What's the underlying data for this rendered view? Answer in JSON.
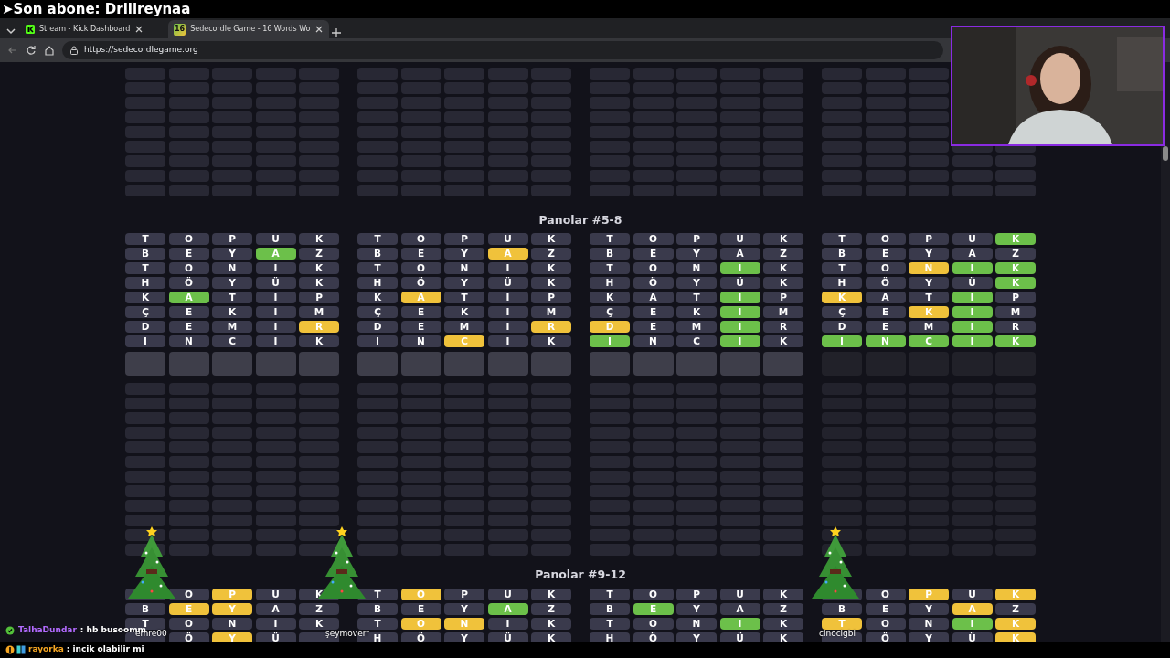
{
  "stream_overlay": {
    "latest_subscriber": "➤Son abone: Drillreynaa"
  },
  "browser": {
    "tabs": [
      {
        "title": "Stream - Kick Dashboard",
        "selected": false
      },
      {
        "title": "Sedecordle Game - 16 Words Wo",
        "selected": true,
        "favicon_text": "16"
      }
    ],
    "url": "https://sedecordlegame.org"
  },
  "sections": [
    {
      "heading": "Panolar #5-8",
      "boards": [
        {
          "solved": false,
          "rows": [
            {
              "tiles": [
                {
                  "letter": "T",
                  "color": "#3a3a4c"
                },
                {
                  "letter": "O",
                  "color": "#3a3a4c"
                },
                {
                  "letter": "P",
                  "color": "#3a3a4c"
                },
                {
                  "letter": "U",
                  "color": "#3a3a4c"
                },
                {
                  "letter": "K",
                  "color": "#3a3a4c"
                }
              ]
            },
            {
              "tiles": [
                {
                  "letter": "B",
                  "color": "#3a3a4c"
                },
                {
                  "letter": "E",
                  "color": "#3a3a4c"
                },
                {
                  "letter": "Y",
                  "color": "#3a3a4c"
                },
                {
                  "letter": "A",
                  "color": "#6cc04a"
                },
                {
                  "letter": "Z",
                  "color": "#3a3a4c"
                }
              ]
            },
            {
              "tiles": [
                {
                  "letter": "T",
                  "color": "#3a3a4c"
                },
                {
                  "letter": "O",
                  "color": "#3a3a4c"
                },
                {
                  "letter": "N",
                  "color": "#3a3a4c"
                },
                {
                  "letter": "I",
                  "color": "#3a3a4c"
                },
                {
                  "letter": "K",
                  "color": "#3a3a4c"
                }
              ]
            },
            {
              "tiles": [
                {
                  "letter": "H",
                  "color": "#3a3a4c"
                },
                {
                  "letter": "Ö",
                  "color": "#3a3a4c"
                },
                {
                  "letter": "Y",
                  "color": "#3a3a4c"
                },
                {
                  "letter": "Ü",
                  "color": "#3a3a4c"
                },
                {
                  "letter": "K",
                  "color": "#3a3a4c"
                }
              ]
            },
            {
              "tiles": [
                {
                  "letter": "K",
                  "color": "#3a3a4c"
                },
                {
                  "letter": "A",
                  "color": "#6cc04a"
                },
                {
                  "letter": "T",
                  "color": "#3a3a4c"
                },
                {
                  "letter": "I",
                  "color": "#3a3a4c"
                },
                {
                  "letter": "P",
                  "color": "#3a3a4c"
                }
              ]
            },
            {
              "tiles": [
                {
                  "letter": "Ç",
                  "color": "#3a3a4c"
                },
                {
                  "letter": "E",
                  "color": "#3a3a4c"
                },
                {
                  "letter": "K",
                  "color": "#3a3a4c"
                },
                {
                  "letter": "I",
                  "color": "#3a3a4c"
                },
                {
                  "letter": "M",
                  "color": "#3a3a4c"
                }
              ]
            },
            {
              "tiles": [
                {
                  "letter": "D",
                  "color": "#3a3a4c"
                },
                {
                  "letter": "E",
                  "color": "#3a3a4c"
                },
                {
                  "letter": "M",
                  "color": "#3a3a4c"
                },
                {
                  "letter": "I",
                  "color": "#3a3a4c"
                },
                {
                  "letter": "R",
                  "color": "#f0c23b"
                }
              ]
            },
            {
              "tiles": [
                {
                  "letter": "I",
                  "color": "#3a3a4c"
                },
                {
                  "letter": "N",
                  "color": "#3a3a4c"
                },
                {
                  "letter": "C",
                  "color": "#3a3a4c"
                },
                {
                  "letter": "I",
                  "color": "#3a3a4c"
                },
                {
                  "letter": "K",
                  "color": "#3a3a4c"
                }
              ]
            }
          ]
        },
        {
          "solved": false,
          "rows": [
            {
              "tiles": [
                {
                  "letter": "T",
                  "color": "#3a3a4c"
                },
                {
                  "letter": "O",
                  "color": "#3a3a4c"
                },
                {
                  "letter": "P",
                  "color": "#3a3a4c"
                },
                {
                  "letter": "U",
                  "color": "#3a3a4c"
                },
                {
                  "letter": "K",
                  "color": "#3a3a4c"
                }
              ]
            },
            {
              "tiles": [
                {
                  "letter": "B",
                  "color": "#3a3a4c"
                },
                {
                  "letter": "E",
                  "color": "#3a3a4c"
                },
                {
                  "letter": "Y",
                  "color": "#3a3a4c"
                },
                {
                  "letter": "A",
                  "color": "#f0c23b"
                },
                {
                  "letter": "Z",
                  "color": "#3a3a4c"
                }
              ]
            },
            {
              "tiles": [
                {
                  "letter": "T",
                  "color": "#3a3a4c"
                },
                {
                  "letter": "O",
                  "color": "#3a3a4c"
                },
                {
                  "letter": "N",
                  "color": "#3a3a4c"
                },
                {
                  "letter": "I",
                  "color": "#3a3a4c"
                },
                {
                  "letter": "K",
                  "color": "#3a3a4c"
                }
              ]
            },
            {
              "tiles": [
                {
                  "letter": "H",
                  "color": "#3a3a4c"
                },
                {
                  "letter": "Ö",
                  "color": "#3a3a4c"
                },
                {
                  "letter": "Y",
                  "color": "#3a3a4c"
                },
                {
                  "letter": "Ü",
                  "color": "#3a3a4c"
                },
                {
                  "letter": "K",
                  "color": "#3a3a4c"
                }
              ]
            },
            {
              "tiles": [
                {
                  "letter": "K",
                  "color": "#3a3a4c"
                },
                {
                  "letter": "A",
                  "color": "#f0c23b"
                },
                {
                  "letter": "T",
                  "color": "#3a3a4c"
                },
                {
                  "letter": "I",
                  "color": "#3a3a4c"
                },
                {
                  "letter": "P",
                  "color": "#3a3a4c"
                }
              ]
            },
            {
              "tiles": [
                {
                  "letter": "Ç",
                  "color": "#3a3a4c"
                },
                {
                  "letter": "E",
                  "color": "#3a3a4c"
                },
                {
                  "letter": "K",
                  "color": "#3a3a4c"
                },
                {
                  "letter": "I",
                  "color": "#3a3a4c"
                },
                {
                  "letter": "M",
                  "color": "#3a3a4c"
                }
              ]
            },
            {
              "tiles": [
                {
                  "letter": "D",
                  "color": "#3a3a4c"
                },
                {
                  "letter": "E",
                  "color": "#3a3a4c"
                },
                {
                  "letter": "M",
                  "color": "#3a3a4c"
                },
                {
                  "letter": "I",
                  "color": "#3a3a4c"
                },
                {
                  "letter": "R",
                  "color": "#f0c23b"
                }
              ]
            },
            {
              "tiles": [
                {
                  "letter": "I",
                  "color": "#3a3a4c"
                },
                {
                  "letter": "N",
                  "color": "#3a3a4c"
                },
                {
                  "letter": "C",
                  "color": "#f0c23b"
                },
                {
                  "letter": "I",
                  "color": "#3a3a4c"
                },
                {
                  "letter": "K",
                  "color": "#3a3a4c"
                }
              ]
            }
          ]
        },
        {
          "solved": false,
          "rows": [
            {
              "tiles": [
                {
                  "letter": "T",
                  "color": "#3a3a4c"
                },
                {
                  "letter": "O",
                  "color": "#3a3a4c"
                },
                {
                  "letter": "P",
                  "color": "#3a3a4c"
                },
                {
                  "letter": "U",
                  "color": "#3a3a4c"
                },
                {
                  "letter": "K",
                  "color": "#3a3a4c"
                }
              ]
            },
            {
              "tiles": [
                {
                  "letter": "B",
                  "color": "#3a3a4c"
                },
                {
                  "letter": "E",
                  "color": "#3a3a4c"
                },
                {
                  "letter": "Y",
                  "color": "#3a3a4c"
                },
                {
                  "letter": "A",
                  "color": "#3a3a4c"
                },
                {
                  "letter": "Z",
                  "color": "#3a3a4c"
                }
              ]
            },
            {
              "tiles": [
                {
                  "letter": "T",
                  "color": "#3a3a4c"
                },
                {
                  "letter": "O",
                  "color": "#3a3a4c"
                },
                {
                  "letter": "N",
                  "color": "#3a3a4c"
                },
                {
                  "letter": "I",
                  "color": "#6cc04a"
                },
                {
                  "letter": "K",
                  "color": "#3a3a4c"
                }
              ]
            },
            {
              "tiles": [
                {
                  "letter": "H",
                  "color": "#3a3a4c"
                },
                {
                  "letter": "Ö",
                  "color": "#3a3a4c"
                },
                {
                  "letter": "Y",
                  "color": "#3a3a4c"
                },
                {
                  "letter": "Ü",
                  "color": "#3a3a4c"
                },
                {
                  "letter": "K",
                  "color": "#3a3a4c"
                }
              ]
            },
            {
              "tiles": [
                {
                  "letter": "K",
                  "color": "#3a3a4c"
                },
                {
                  "letter": "A",
                  "color": "#3a3a4c"
                },
                {
                  "letter": "T",
                  "color": "#3a3a4c"
                },
                {
                  "letter": "I",
                  "color": "#6cc04a"
                },
                {
                  "letter": "P",
                  "color": "#3a3a4c"
                }
              ]
            },
            {
              "tiles": [
                {
                  "letter": "Ç",
                  "color": "#3a3a4c"
                },
                {
                  "letter": "E",
                  "color": "#3a3a4c"
                },
                {
                  "letter": "K",
                  "color": "#3a3a4c"
                },
                {
                  "letter": "I",
                  "color": "#6cc04a"
                },
                {
                  "letter": "M",
                  "color": "#3a3a4c"
                }
              ]
            },
            {
              "tiles": [
                {
                  "letter": "D",
                  "color": "#f0c23b"
                },
                {
                  "letter": "E",
                  "color": "#3a3a4c"
                },
                {
                  "letter": "M",
                  "color": "#3a3a4c"
                },
                {
                  "letter": "I",
                  "color": "#6cc04a"
                },
                {
                  "letter": "R",
                  "color": "#3a3a4c"
                }
              ]
            },
            {
              "tiles": [
                {
                  "letter": "I",
                  "color": "#6cc04a"
                },
                {
                  "letter": "N",
                  "color": "#3a3a4c"
                },
                {
                  "letter": "C",
                  "color": "#3a3a4c"
                },
                {
                  "letter": "I",
                  "color": "#6cc04a"
                },
                {
                  "letter": "K",
                  "color": "#3a3a4c"
                }
              ]
            }
          ]
        },
        {
          "solved": true,
          "rows": [
            {
              "tiles": [
                {
                  "letter": "T",
                  "color": "#3a3a4c"
                },
                {
                  "letter": "O",
                  "color": "#3a3a4c"
                },
                {
                  "letter": "P",
                  "color": "#3a3a4c"
                },
                {
                  "letter": "U",
                  "color": "#3a3a4c"
                },
                {
                  "letter": "K",
                  "color": "#6cc04a"
                }
              ]
            },
            {
              "tiles": [
                {
                  "letter": "B",
                  "color": "#3a3a4c"
                },
                {
                  "letter": "E",
                  "color": "#3a3a4c"
                },
                {
                  "letter": "Y",
                  "color": "#3a3a4c"
                },
                {
                  "letter": "A",
                  "color": "#3a3a4c"
                },
                {
                  "letter": "Z",
                  "color": "#3a3a4c"
                }
              ]
            },
            {
              "tiles": [
                {
                  "letter": "T",
                  "color": "#3a3a4c"
                },
                {
                  "letter": "O",
                  "color": "#3a3a4c"
                },
                {
                  "letter": "N",
                  "color": "#f0c23b"
                },
                {
                  "letter": "I",
                  "color": "#6cc04a"
                },
                {
                  "letter": "K",
                  "color": "#6cc04a"
                }
              ]
            },
            {
              "tiles": [
                {
                  "letter": "H",
                  "color": "#3a3a4c"
                },
                {
                  "letter": "Ö",
                  "color": "#3a3a4c"
                },
                {
                  "letter": "Y",
                  "color": "#3a3a4c"
                },
                {
                  "letter": "Ü",
                  "color": "#3a3a4c"
                },
                {
                  "letter": "K",
                  "color": "#6cc04a"
                }
              ]
            },
            {
              "tiles": [
                {
                  "letter": "K",
                  "color": "#f0c23b"
                },
                {
                  "letter": "A",
                  "color": "#3a3a4c"
                },
                {
                  "letter": "T",
                  "color": "#3a3a4c"
                },
                {
                  "letter": "I",
                  "color": "#6cc04a"
                },
                {
                  "letter": "P",
                  "color": "#3a3a4c"
                }
              ]
            },
            {
              "tiles": [
                {
                  "letter": "Ç",
                  "color": "#3a3a4c"
                },
                {
                  "letter": "E",
                  "color": "#3a3a4c"
                },
                {
                  "letter": "K",
                  "color": "#f0c23b"
                },
                {
                  "letter": "I",
                  "color": "#6cc04a"
                },
                {
                  "letter": "M",
                  "color": "#3a3a4c"
                }
              ]
            },
            {
              "tiles": [
                {
                  "letter": "D",
                  "color": "#3a3a4c"
                },
                {
                  "letter": "E",
                  "color": "#3a3a4c"
                },
                {
                  "letter": "M",
                  "color": "#3a3a4c"
                },
                {
                  "letter": "I",
                  "color": "#6cc04a"
                },
                {
                  "letter": "R",
                  "color": "#3a3a4c"
                }
              ]
            },
            {
              "tiles": [
                {
                  "letter": "I",
                  "color": "#6cc04a"
                },
                {
                  "letter": "N",
                  "color": "#6cc04a"
                },
                {
                  "letter": "C",
                  "color": "#6cc04a"
                },
                {
                  "letter": "I",
                  "color": "#6cc04a"
                },
                {
                  "letter": "K",
                  "color": "#6cc04a"
                }
              ]
            }
          ]
        }
      ]
    },
    {
      "heading": "Panolar #9-12",
      "boards": [
        {
          "rows": [
            {
              "tiles": [
                {
                  "color": "#3a3a4c"
                },
                {
                  "letter": "O",
                  "color": "#3a3a4c"
                },
                {
                  "letter": "P",
                  "color": "#f0c23b"
                },
                {
                  "letter": "U",
                  "color": "#3a3a4c"
                },
                {
                  "letter": "K",
                  "color": "#3a3a4c"
                }
              ]
            },
            {
              "tiles": [
                {
                  "letter": "B",
                  "color": "#3a3a4c"
                },
                {
                  "letter": "E",
                  "color": "#f0c23b"
                },
                {
                  "letter": "Y",
                  "color": "#f0c23b"
                },
                {
                  "letter": "A",
                  "color": "#3a3a4c"
                },
                {
                  "letter": "Z",
                  "color": "#3a3a4c"
                }
              ]
            },
            {
              "tiles": [
                {
                  "letter": "T",
                  "color": "#3a3a4c"
                },
                {
                  "letter": "O",
                  "color": "#3a3a4c"
                },
                {
                  "letter": "N",
                  "color": "#3a3a4c"
                },
                {
                  "letter": "I",
                  "color": "#3a3a4c"
                },
                {
                  "letter": "K",
                  "color": "#3a3a4c"
                }
              ]
            },
            {
              "tiles": [
                {
                  "color": "#3a3a4c"
                },
                {
                  "letter": "Ö",
                  "color": "#3a3a4c"
                },
                {
                  "letter": "Y",
                  "color": "#f0c23b"
                },
                {
                  "letter": "Ü",
                  "color": "#3a3a4c"
                },
                {
                  "color": "#3a3a4c"
                }
              ]
            }
          ]
        },
        {
          "rows": [
            {
              "tiles": [
                {
                  "letter": "T",
                  "color": "#3a3a4c"
                },
                {
                  "letter": "O",
                  "color": "#f0c23b"
                },
                {
                  "letter": "P",
                  "color": "#3a3a4c"
                },
                {
                  "letter": "U",
                  "color": "#3a3a4c"
                },
                {
                  "letter": "K",
                  "color": "#3a3a4c"
                }
              ]
            },
            {
              "tiles": [
                {
                  "letter": "B",
                  "color": "#3a3a4c"
                },
                {
                  "letter": "E",
                  "color": "#3a3a4c"
                },
                {
                  "letter": "Y",
                  "color": "#3a3a4c"
                },
                {
                  "letter": "A",
                  "color": "#6cc04a"
                },
                {
                  "letter": "Z",
                  "color": "#3a3a4c"
                }
              ]
            },
            {
              "tiles": [
                {
                  "letter": "T",
                  "color": "#3a3a4c"
                },
                {
                  "letter": "O",
                  "color": "#f0c23b"
                },
                {
                  "letter": "N",
                  "color": "#f0c23b"
                },
                {
                  "letter": "I",
                  "color": "#3a3a4c"
                },
                {
                  "letter": "K",
                  "color": "#3a3a4c"
                }
              ]
            },
            {
              "tiles": [
                {
                  "letter": "H",
                  "color": "#3a3a4c"
                },
                {
                  "letter": "Ö",
                  "color": "#3a3a4c"
                },
                {
                  "letter": "Y",
                  "color": "#3a3a4c"
                },
                {
                  "letter": "Ü",
                  "color": "#3a3a4c"
                },
                {
                  "letter": "K",
                  "color": "#3a3a4c"
                }
              ]
            }
          ]
        },
        {
          "rows": [
            {
              "tiles": [
                {
                  "letter": "T",
                  "color": "#3a3a4c"
                },
                {
                  "letter": "O",
                  "color": "#3a3a4c"
                },
                {
                  "letter": "P",
                  "color": "#3a3a4c"
                },
                {
                  "letter": "U",
                  "color": "#3a3a4c"
                },
                {
                  "letter": "K",
                  "color": "#3a3a4c"
                }
              ]
            },
            {
              "tiles": [
                {
                  "letter": "B",
                  "color": "#3a3a4c"
                },
                {
                  "letter": "E",
                  "color": "#6cc04a"
                },
                {
                  "letter": "Y",
                  "color": "#3a3a4c"
                },
                {
                  "letter": "A",
                  "color": "#3a3a4c"
                },
                {
                  "letter": "Z",
                  "color": "#3a3a4c"
                }
              ]
            },
            {
              "tiles": [
                {
                  "letter": "T",
                  "color": "#3a3a4c"
                },
                {
                  "letter": "O",
                  "color": "#3a3a4c"
                },
                {
                  "letter": "N",
                  "color": "#3a3a4c"
                },
                {
                  "letter": "I",
                  "color": "#6cc04a"
                },
                {
                  "letter": "K",
                  "color": "#3a3a4c"
                }
              ]
            },
            {
              "tiles": [
                {
                  "letter": "H",
                  "color": "#3a3a4c"
                },
                {
                  "letter": "Ö",
                  "color": "#3a3a4c"
                },
                {
                  "letter": "Y",
                  "color": "#3a3a4c"
                },
                {
                  "letter": "Ü",
                  "color": "#3a3a4c"
                },
                {
                  "letter": "K",
                  "color": "#3a3a4c"
                }
              ]
            }
          ]
        },
        {
          "rows": [
            {
              "tiles": [
                {
                  "color": "#3a3a4c"
                },
                {
                  "letter": "O",
                  "color": "#3a3a4c"
                },
                {
                  "letter": "P",
                  "color": "#f0c23b"
                },
                {
                  "letter": "U",
                  "color": "#3a3a4c"
                },
                {
                  "letter": "K",
                  "color": "#f0c23b"
                }
              ]
            },
            {
              "tiles": [
                {
                  "letter": "B",
                  "color": "#3a3a4c"
                },
                {
                  "letter": "E",
                  "color": "#3a3a4c"
                },
                {
                  "letter": "Y",
                  "color": "#3a3a4c"
                },
                {
                  "letter": "A",
                  "color": "#f0c23b"
                },
                {
                  "letter": "Z",
                  "color": "#3a3a4c"
                }
              ]
            },
            {
              "tiles": [
                {
                  "letter": "T",
                  "color": "#f0c23b"
                },
                {
                  "letter": "O",
                  "color": "#3a3a4c"
                },
                {
                  "letter": "N",
                  "color": "#3a3a4c"
                },
                {
                  "letter": "I",
                  "color": "#6cc04a"
                },
                {
                  "letter": "K",
                  "color": "#f0c23b"
                }
              ]
            },
            {
              "tiles": [
                {
                  "color": "#3a3a4c"
                },
                {
                  "letter": "Ö",
                  "color": "#3a3a4c"
                },
                {
                  "letter": "Y",
                  "color": "#3a3a4c"
                },
                {
                  "letter": "Ü",
                  "color": "#3a3a4c"
                },
                {
                  "letter": "K",
                  "color": "#f0c23b"
                }
              ]
            }
          ]
        }
      ]
    }
  ],
  "trees": [
    {
      "label": "emre00"
    },
    {
      "label": "şeymoverr"
    },
    {
      "label": "cinocigbl"
    }
  ],
  "chat": [
    {
      "user": "TalhaDundar",
      "message": " : hb busoomm",
      "color": "#b36bff"
    },
    {
      "user": "rayorka",
      "message": " : incik olabilir mi",
      "color": "#f5a623"
    }
  ]
}
